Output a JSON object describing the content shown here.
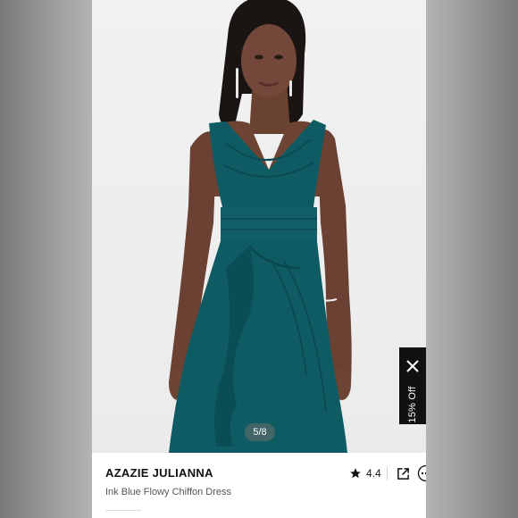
{
  "product": {
    "brand": "AZAZIE JULIANNA",
    "name": "Ink Blue Flowy Chiffon Dress",
    "rating": "4.4"
  },
  "gallery": {
    "counter": "5/8",
    "image_subject": "model wearing teal chiffon v-neck dress"
  },
  "promo": {
    "label": "15% Off"
  },
  "icons": {
    "rating": "star-icon",
    "share": "share-icon",
    "more": "more-icon",
    "close": "close-icon"
  },
  "colors": {
    "dress": "#0f5b63",
    "promo_background": "#111111",
    "brand_text": "#111111"
  }
}
